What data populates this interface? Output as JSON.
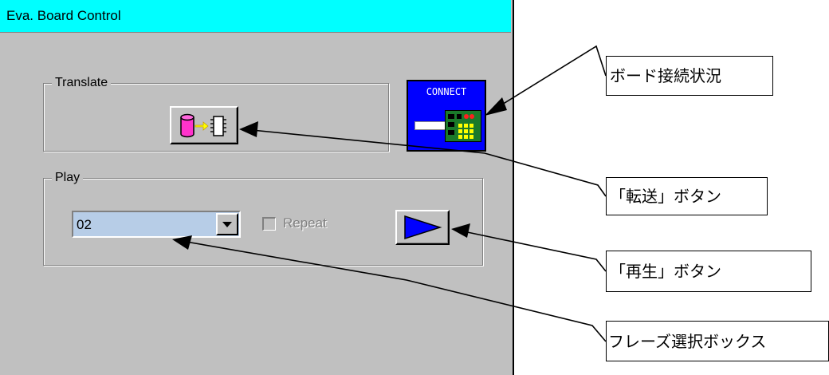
{
  "window": {
    "title": "Eva. Board Control"
  },
  "translate_group": {
    "label": "Translate",
    "button_icon": "database-to-chip-icon"
  },
  "play_group": {
    "label": "Play",
    "phrase_value": "02",
    "repeat_label": "Repeat",
    "repeat_checked": false,
    "repeat_enabled": false,
    "play_icon": "play-triangle-icon"
  },
  "connect_status": {
    "label": "CONNECT",
    "icon": "cable-board-icon"
  },
  "callouts": {
    "board_status": "ボード接続状況",
    "transfer_button": "「転送」ボタン",
    "play_button": "「再生」ボタン",
    "phrase_box": "フレーズ選択ボックス"
  },
  "colors": {
    "titlebar": "#00ffff",
    "panel": "#c0c0c0",
    "combo_bg": "#b7cde7",
    "play_triangle": "#0000ff",
    "connect_bg": "#0000ff"
  }
}
